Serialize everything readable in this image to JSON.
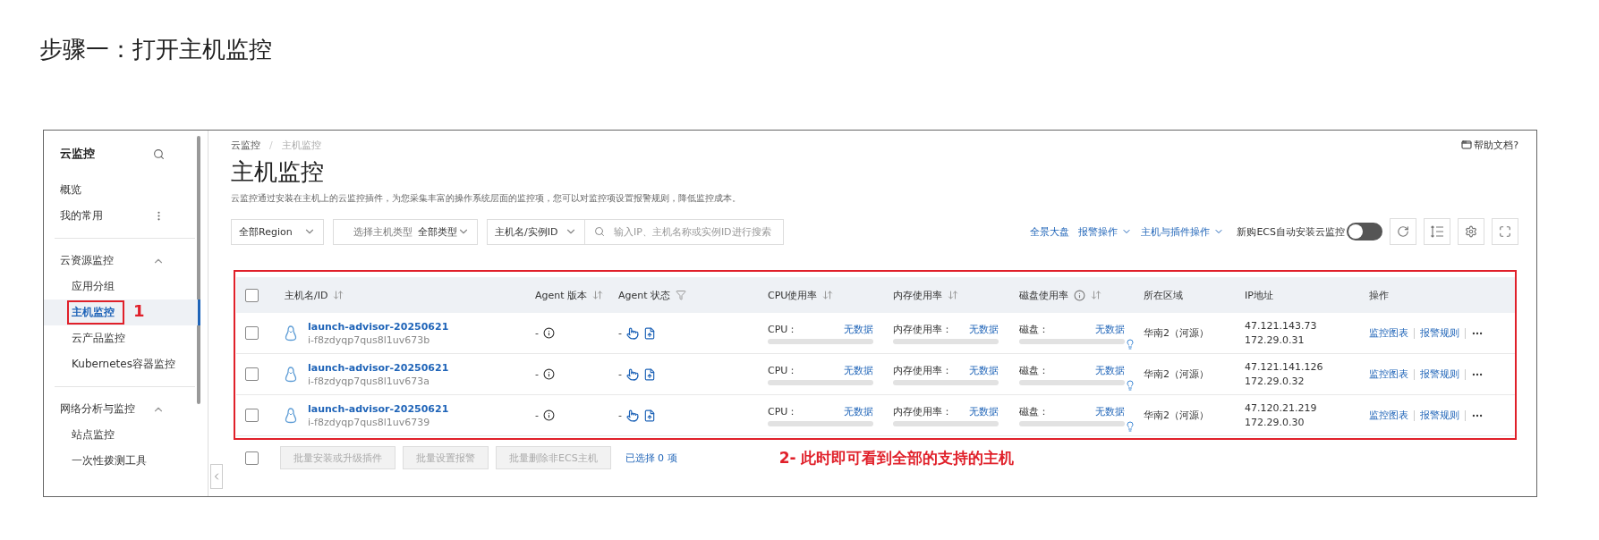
{
  "heading": "步骤一：打开主机监控",
  "sidebar": {
    "title": "云监控",
    "items": [
      {
        "label": "概览",
        "menu": false
      },
      {
        "label": "我的常用",
        "menu": true
      }
    ],
    "groups": [
      {
        "label": "云资源监控",
        "expanded": true,
        "children": [
          {
            "label": "应用分组",
            "selected": false,
            "highlighted": false
          },
          {
            "label": "主机监控",
            "selected": true,
            "highlighted": true
          },
          {
            "label": "云产品监控",
            "selected": false,
            "highlighted": false
          },
          {
            "label": "Kubernetes容器监控",
            "selected": false,
            "highlighted": false
          }
        ]
      },
      {
        "label": "网络分析与监控",
        "expanded": true,
        "children": [
          {
            "label": "站点监控",
            "selected": false,
            "highlighted": false
          },
          {
            "label": "一次性拨测工具",
            "selected": false,
            "highlighted": false
          }
        ]
      }
    ]
  },
  "breadcrumb": [
    "云监控",
    "主机监控"
  ],
  "breadcrumb_separator": "/",
  "help_link": "帮助文档?",
  "page_title": "主机监控",
  "description": "云监控通过安装在主机上的云监控插件，为您采集丰富的操作系统层面的监控项，您可以对监控项设置报警规则，降低监控成本。",
  "filters": {
    "region": "全部Region",
    "type_label": "选择主机类型",
    "type_value": "全部类型",
    "search_by": "主机名/实例ID",
    "search_placeholder": "输入IP、主机名称或实例ID进行搜索"
  },
  "actions": [
    {
      "label": "全景大盘",
      "dropdown": false
    },
    {
      "label": "报警操作",
      "dropdown": true
    },
    {
      "label": "主机与插件操作",
      "dropdown": true
    }
  ],
  "auto_install": {
    "label": "新购ECS自动安装云监控",
    "on": false
  },
  "table": {
    "highlighted": true,
    "select_all_checked": false,
    "columns": [
      {
        "label": "主机名/ID",
        "sortable": true,
        "filter": false,
        "info": false
      },
      {
        "label": "Agent 版本",
        "sortable": true,
        "filter": false,
        "info": false
      },
      {
        "label": "Agent 状态",
        "sortable": false,
        "filter": true,
        "info": false
      },
      {
        "label": "CPU使用率",
        "sortable": true,
        "filter": false,
        "info": false
      },
      {
        "label": "内存使用率",
        "sortable": true,
        "filter": false,
        "info": false
      },
      {
        "label": "磁盘使用率",
        "sortable": true,
        "filter": false,
        "info": true
      },
      {
        "label": "所在区域",
        "sortable": false,
        "filter": false,
        "info": false
      },
      {
        "label": "IP地址",
        "sortable": false,
        "filter": false,
        "info": false
      },
      {
        "label": "操作",
        "sortable": false,
        "filter": false,
        "info": false
      }
    ],
    "rows": [
      {
        "checked": false,
        "name": "launch-advisor-20250621",
        "instance_id": "i-f8zdyqp7qus8l1uv673b",
        "agent_version": "-",
        "agent_status": "-",
        "cpu_label": "CPU：",
        "cpu_value": "无数据",
        "mem_label": "内存使用率：",
        "mem_value": "无数据",
        "disk_label": "磁盘：",
        "disk_value": "无数据",
        "region": "华南2（河源）",
        "public_ip": "47.121.143.73",
        "private_ip": "172.29.0.31",
        "ops": [
          "监控图表",
          "报警规则"
        ]
      },
      {
        "checked": false,
        "name": "launch-advisor-20250621",
        "instance_id": "i-f8zdyqp7qus8l1uv673a",
        "agent_version": "-",
        "agent_status": "-",
        "cpu_label": "CPU：",
        "cpu_value": "无数据",
        "mem_label": "内存使用率：",
        "mem_value": "无数据",
        "disk_label": "磁盘：",
        "disk_value": "无数据",
        "region": "华南2（河源）",
        "public_ip": "47.121.141.126",
        "private_ip": "172.29.0.32",
        "ops": [
          "监控图表",
          "报警规则"
        ]
      },
      {
        "checked": false,
        "name": "launch-advisor-20250621",
        "instance_id": "i-f8zdyqp7qus8l1uv6739",
        "agent_version": "-",
        "agent_status": "-",
        "cpu_label": "CPU：",
        "cpu_value": "无数据",
        "mem_label": "内存使用率：",
        "mem_value": "无数据",
        "disk_label": "磁盘：",
        "disk_value": "无数据",
        "region": "华南2（河源）",
        "public_ip": "47.120.21.219",
        "private_ip": "172.29.0.30",
        "ops": [
          "监控图表",
          "报警规则"
        ]
      }
    ]
  },
  "footer": {
    "select_all_checked": false,
    "buttons": [
      {
        "label": "批量安装或升级插件",
        "disabled": true
      },
      {
        "label": "批量设置报警",
        "disabled": true
      },
      {
        "label": "批量删除非ECS主机",
        "disabled": true
      }
    ],
    "selected_count": "已选择 0 项"
  },
  "annotations": [
    "1",
    "2- 此时即可看到全部的支持的主机"
  ]
}
